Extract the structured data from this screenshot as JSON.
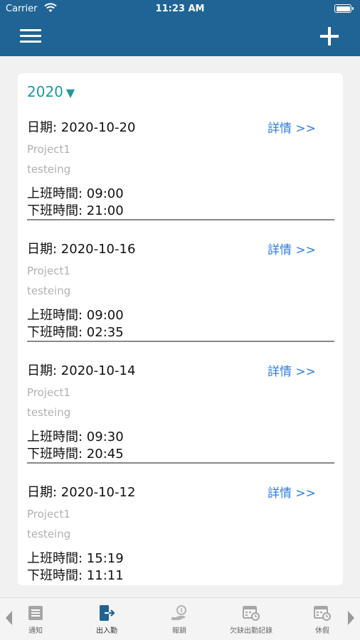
{
  "status_bar": {
    "carrier": "Carrier",
    "time": "11:23 AM"
  },
  "year_filter": {
    "value": "2020",
    "arrow": "▼"
  },
  "records": [
    {
      "date": "日期: 2020-10-20",
      "detail": "詳情 >>",
      "project": "Project1",
      "note": "testeing",
      "clock_in": "上班時間: 09:00",
      "clock_out": "下班時間: 21:00"
    },
    {
      "date": "日期: 2020-10-16",
      "detail": "詳情 >>",
      "project": "Project1",
      "note": "testeing",
      "clock_in": "上班時間: 09:00",
      "clock_out": "下班時間: 02:35"
    },
    {
      "date": "日期: 2020-10-14",
      "detail": "詳情 >>",
      "project": "Project1",
      "note": "testeing",
      "clock_in": "上班時間: 09:30",
      "clock_out": "下班時間: 20:45"
    },
    {
      "date": "日期: 2020-10-12",
      "detail": "詳情 >>",
      "project": "Project1",
      "note": "testeing",
      "clock_in": "上班時間: 15:19",
      "clock_out": "下班時間: 11:11"
    }
  ],
  "tabs": [
    {
      "label": "通知",
      "icon": "notification-icon"
    },
    {
      "label": "出入勤",
      "icon": "clock-in-out-icon",
      "active": true
    },
    {
      "label": "報銷",
      "icon": "reimbursement-icon"
    },
    {
      "label": "欠缺出勤記錄",
      "icon": "missing-attendance-icon"
    },
    {
      "label": "休假",
      "icon": "leave-icon"
    }
  ],
  "colors": {
    "header": "#1f6494",
    "accent": "#1a9aa0",
    "link": "#2f7de0",
    "active_tab": "#1f6494"
  }
}
